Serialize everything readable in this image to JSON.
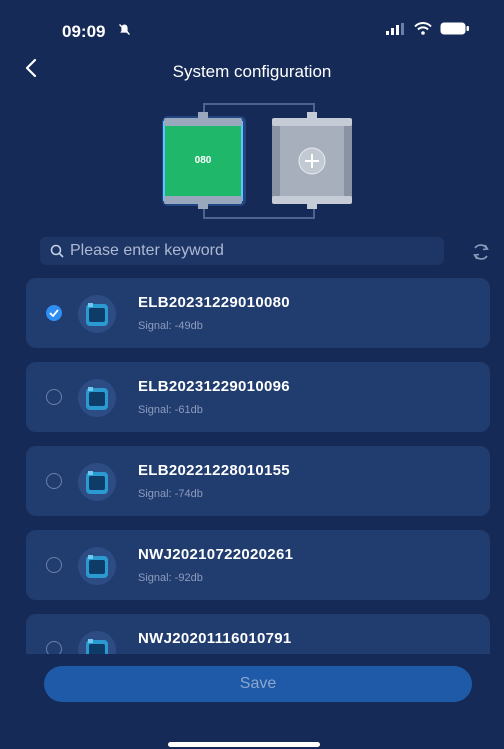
{
  "status": {
    "time": "09:09"
  },
  "header": {
    "title": "System configuration"
  },
  "battery": {
    "label": "080"
  },
  "search": {
    "placeholder": "Please enter keyword"
  },
  "devices": [
    {
      "name": "ELB20231229010080",
      "signal": "Signal: -49db",
      "selected": true
    },
    {
      "name": "ELB20231229010096",
      "signal": "Signal: -61db",
      "selected": false
    },
    {
      "name": "ELB20221228010155",
      "signal": "Signal: -74db",
      "selected": false
    },
    {
      "name": "NWJ20210722020261",
      "signal": "Signal: -92db",
      "selected": false
    },
    {
      "name": "NWJ20201116010791",
      "signal": "",
      "selected": false
    }
  ],
  "footer": {
    "save_label": "Save"
  },
  "colors": {
    "background": "#152a57",
    "card": "#213d70",
    "accent": "#2f8ef4",
    "battery_green": "#1fb86a"
  }
}
